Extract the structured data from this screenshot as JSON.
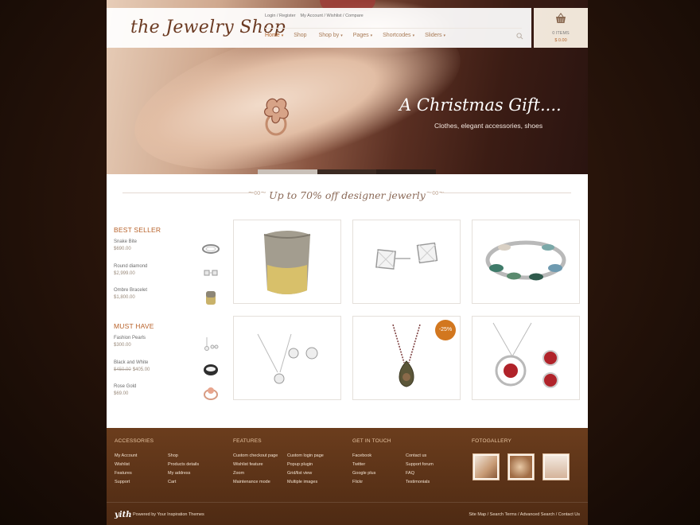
{
  "header": {
    "logo": "the Jewelry Shop",
    "top_links": [
      "Login / Register",
      "My Account / Wishlist / Compare"
    ],
    "nav": [
      {
        "label": "Home",
        "arrow": "▾"
      },
      {
        "label": "Shop",
        "arrow": ""
      },
      {
        "label": "Shop by",
        "arrow": "▾"
      },
      {
        "label": "Pages",
        "arrow": "▾"
      },
      {
        "label": "Shortcodes",
        "arrow": "▾"
      },
      {
        "label": "Sliders",
        "arrow": "▾"
      }
    ],
    "cart": {
      "items": "0 ITEMS",
      "total": "$ 0.00"
    }
  },
  "hero": {
    "slogan": "A Christmas Gift....",
    "subtitle": "Clothes, elegant accessories, shoes"
  },
  "banner": "Up to 70% off designer jewerly",
  "sidebar": {
    "best_seller": {
      "title": "BEST SELLER",
      "items": [
        {
          "name": "Snake Bite",
          "price": "$690.00",
          "old_price": ""
        },
        {
          "name": "Round diamond",
          "price": "$2,999.00",
          "old_price": ""
        },
        {
          "name": "Ombre Bracelet",
          "price": "$1,800.00",
          "old_price": ""
        }
      ]
    },
    "must_have": {
      "title": "MUST HAVE",
      "items": [
        {
          "name": "Fashion Pearls",
          "price": "$300.00",
          "old_price": ""
        },
        {
          "name": "Black and White",
          "price": "$405.00",
          "old_price": "$450.00"
        },
        {
          "name": "Rose Gold",
          "price": "$69.00",
          "old_price": ""
        }
      ]
    }
  },
  "products": {
    "sale_badge": "-25%"
  },
  "footer": {
    "columns": [
      {
        "title": "ACCESSORIES",
        "col1": [
          "My Account",
          "Wishlist",
          "Features",
          "Support"
        ],
        "col2": [
          "Shop",
          "Products details",
          "My address",
          "Cart"
        ]
      },
      {
        "title": "FEATURES",
        "col1": [
          "Custom checkout page",
          "Wishlist feature",
          "Zoom",
          "Maintenance mode"
        ],
        "col2": [
          "Custom login page",
          "Popup plugin",
          "Grid/list view",
          "Multiple images"
        ]
      },
      {
        "title": "GET IN TOUCH",
        "col1": [
          "Facebook",
          "Twitter",
          "Google plus",
          "Flickr"
        ],
        "col2": [
          "Contact us",
          "Support forum",
          "FAQ",
          "Testimonials"
        ]
      }
    ],
    "gallery_title": "FOTOGALLERY",
    "brand": "yith",
    "powered": "Powered by Your Inspiration Themes",
    "bottom_links": "Site Map / Search Terms / Advanced Search / Contact Us"
  },
  "colors": {
    "accent": "#b8622a",
    "sale": "#d2771f",
    "footer": "#5a3017"
  },
  "icons": [
    "search-icon",
    "cart-basket-icon"
  ]
}
